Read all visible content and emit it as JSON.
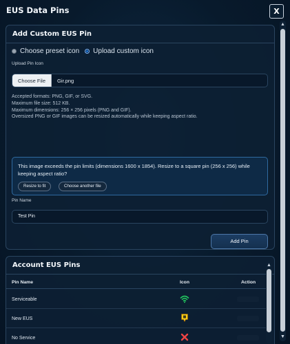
{
  "window": {
    "title": "EUS Data Pins",
    "close_label": "X"
  },
  "custom_pin": {
    "header": "Add Custom EUS Pin",
    "radio_preset": "Choose preset icon",
    "radio_upload": "Upload custom icon",
    "selected_mode": "upload",
    "upload_label": "Upload Pin Icon",
    "choose_file_label": "Choose File",
    "file_name": "Gir.png",
    "info_lines": [
      "Accepted formats: PNG, GIF, or SVG.",
      "Maximum file size: 512 KB.",
      "Maximum dimensions: 256 × 256 pixels (PNG and GIF).",
      "Oversized PNG or GIF images can be resized automatically while keeping aspect ratio."
    ],
    "alert_text": "This image exceeds the pin limits (dimensions 1600 x 1854). Resize to a square pin (256 x 256) while keeping aspect ratio?",
    "resize_button": "Resize to fit",
    "choose_another_button": "Choose another file",
    "pin_name_label": "Pin Name",
    "pin_name_value": "Test Pin",
    "add_pin_button": "Add Pin"
  },
  "account_pins": {
    "header": "Account EUS Pins",
    "columns": {
      "name": "Pin Name",
      "icon": "Icon",
      "action": "Action"
    },
    "rows": [
      {
        "name": "Serviceable",
        "icon": "wifi-signal-icon",
        "icon_color": "#22c55e"
      },
      {
        "name": "New EUS",
        "icon": "yellow-pin-icon",
        "icon_color": "#facc15"
      },
      {
        "name": "No Service",
        "icon": "red-x-icon",
        "icon_color": "#ef4444"
      }
    ]
  },
  "colors": {
    "accent": "#1f7ae0",
    "alert_border": "#2f6aa0",
    "background": "#081a2c"
  }
}
